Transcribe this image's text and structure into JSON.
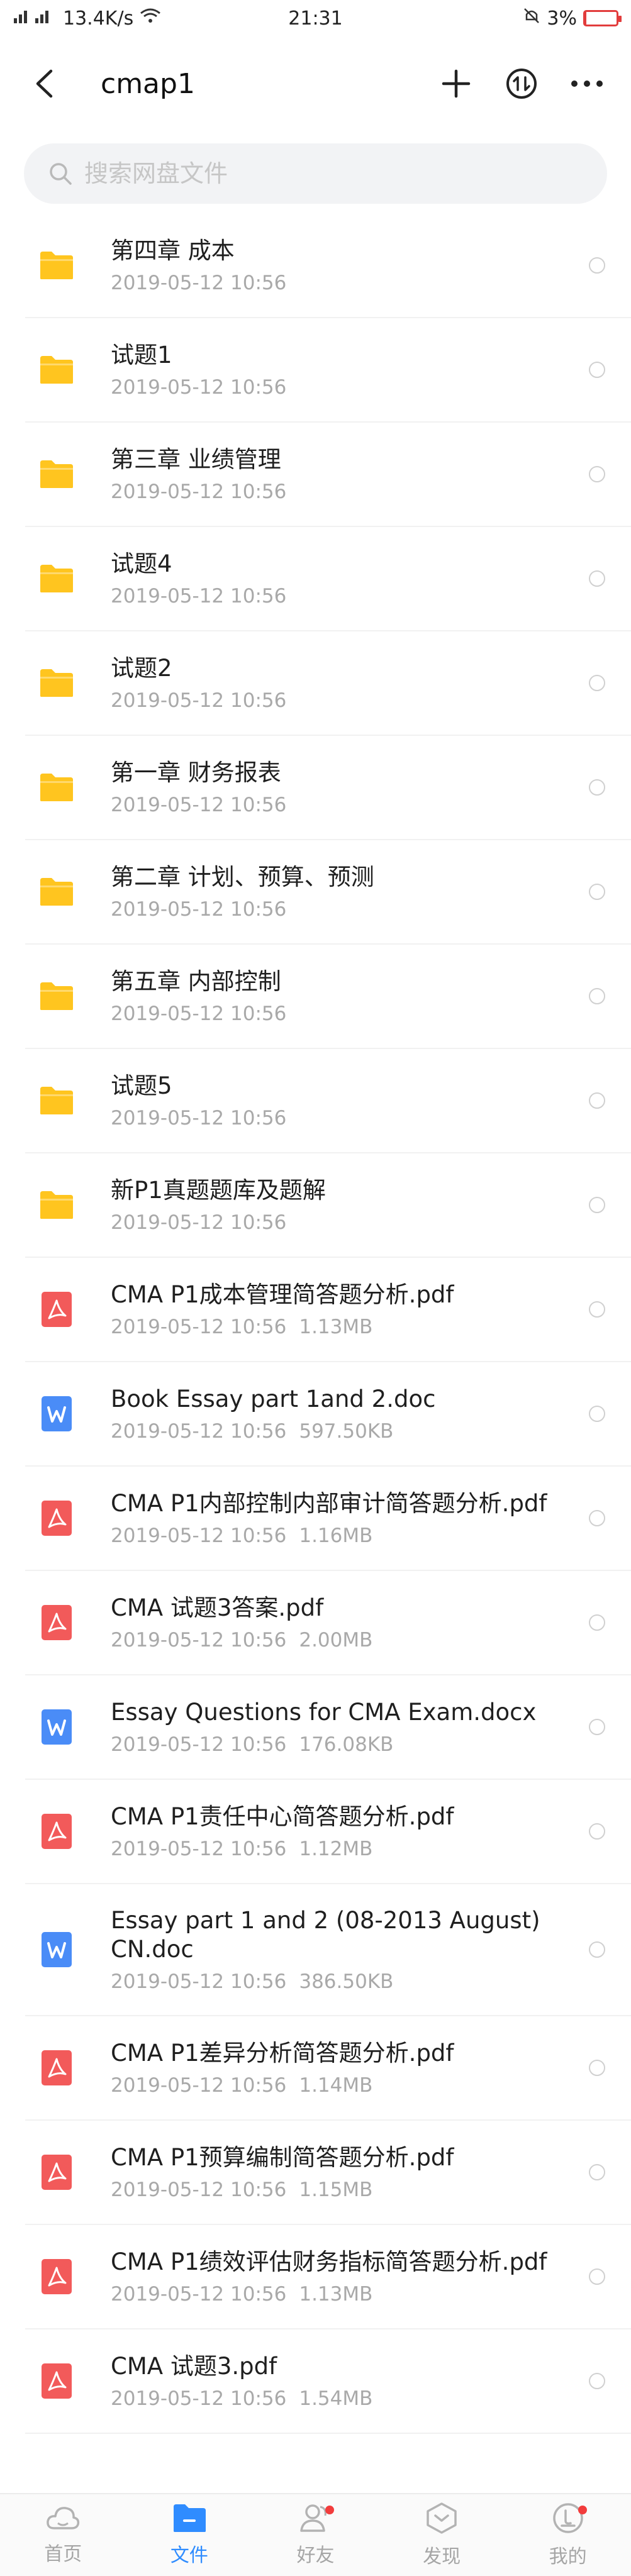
{
  "status_bar": {
    "left_text": "13.4K/s",
    "time": "21:31",
    "battery_text": "3%",
    "battery_level": 0.03
  },
  "header": {
    "title": "cmap1"
  },
  "search": {
    "placeholder": "搜索网盘文件"
  },
  "files": [
    {
      "type": "folder",
      "name": "第四章 成本",
      "date": "2019-05-12  10:56",
      "size": ""
    },
    {
      "type": "folder",
      "name": "试题1",
      "date": "2019-05-12  10:56",
      "size": ""
    },
    {
      "type": "folder",
      "name": "第三章 业绩管理",
      "date": "2019-05-12  10:56",
      "size": ""
    },
    {
      "type": "folder",
      "name": "试题4",
      "date": "2019-05-12  10:56",
      "size": ""
    },
    {
      "type": "folder",
      "name": "试题2",
      "date": "2019-05-12  10:56",
      "size": ""
    },
    {
      "type": "folder",
      "name": "第一章 财务报表",
      "date": "2019-05-12  10:56",
      "size": ""
    },
    {
      "type": "folder",
      "name": "第二章 计划、预算、预测",
      "date": "2019-05-12  10:56",
      "size": ""
    },
    {
      "type": "folder",
      "name": "第五章 内部控制",
      "date": "2019-05-12  10:56",
      "size": ""
    },
    {
      "type": "folder",
      "name": "试题5",
      "date": "2019-05-12  10:56",
      "size": ""
    },
    {
      "type": "folder",
      "name": "新P1真题题库及题解",
      "date": "2019-05-12  10:56",
      "size": ""
    },
    {
      "type": "pdf",
      "name": "CMA P1成本管理简答题分析.pdf",
      "date": "2019-05-12  10:56",
      "size": "1.13MB"
    },
    {
      "type": "doc",
      "name": "Book Essay part 1and 2.doc",
      "date": "2019-05-12  10:56",
      "size": "597.50KB"
    },
    {
      "type": "pdf",
      "name": "CMA P1内部控制内部审计简答题分析.pdf",
      "date": "2019-05-12  10:56",
      "size": "1.16MB"
    },
    {
      "type": "pdf",
      "name": "CMA 试题3答案.pdf",
      "date": "2019-05-12  10:56",
      "size": "2.00MB"
    },
    {
      "type": "doc",
      "name": "Essay Questions for CMA Exam.docx",
      "date": "2019-05-12  10:56",
      "size": "176.08KB"
    },
    {
      "type": "pdf",
      "name": "CMA P1责任中心简答题分析.pdf",
      "date": "2019-05-12  10:56",
      "size": "1.12MB"
    },
    {
      "type": "doc",
      "name": "Essay part 1 and 2 (08-2013 August) CN.doc",
      "date": "2019-05-12  10:56",
      "size": "386.50KB"
    },
    {
      "type": "pdf",
      "name": "CMA P1差异分析简答题分析.pdf",
      "date": "2019-05-12  10:56",
      "size": "1.14MB"
    },
    {
      "type": "pdf",
      "name": "CMA P1预算编制简答题分析.pdf",
      "date": "2019-05-12  10:56",
      "size": "1.15MB"
    },
    {
      "type": "pdf",
      "name": "CMA P1绩效评估财务指标简答题分析.pdf",
      "date": "2019-05-12  10:56",
      "size": "1.13MB"
    },
    {
      "type": "pdf",
      "name": "CMA 试题3.pdf",
      "date": "2019-05-12  10:56",
      "size": "1.54MB"
    }
  ],
  "tabs": [
    {
      "label": "首页",
      "icon": "cloud-icon",
      "active": false,
      "badge": false
    },
    {
      "label": "文件",
      "icon": "folder-icon",
      "active": true,
      "badge": false
    },
    {
      "label": "好友",
      "icon": "friends-icon",
      "active": false,
      "badge": true
    },
    {
      "label": "发现",
      "icon": "discover-icon",
      "active": false,
      "badge": false
    },
    {
      "label": "我的",
      "icon": "profile-icon",
      "active": false,
      "badge": true
    }
  ],
  "colors": {
    "folder": "#FFC51F",
    "pdf": "#F25A5A",
    "doc": "#4A8CF7",
    "accent": "#2F8CFF",
    "badge": "#F23C3C"
  }
}
